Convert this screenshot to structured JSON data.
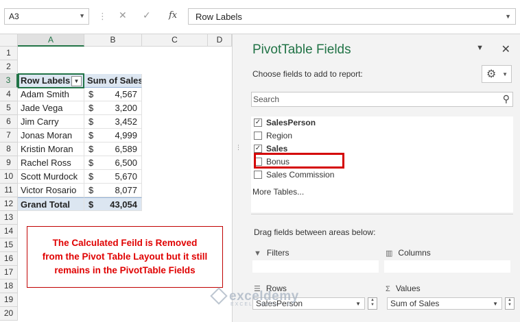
{
  "formula_bar": {
    "name_box": "A3",
    "cancel_icon": "✕",
    "enter_icon": "✓",
    "fx_label": "fx",
    "formula": "Row Labels"
  },
  "grid": {
    "columns": [
      "A",
      "B",
      "C",
      "D"
    ],
    "rows": [
      "1",
      "2",
      "3",
      "4",
      "5",
      "6",
      "7",
      "8",
      "9",
      "10",
      "11",
      "12",
      "13",
      "14",
      "15",
      "16",
      "17",
      "18",
      "19",
      "20"
    ],
    "header": {
      "label": "Row Labels",
      "value": "Sum of Sales"
    },
    "data": [
      {
        "name": "Adam Smith",
        "currency": "$",
        "value": "4,567"
      },
      {
        "name": "Jade Vega",
        "currency": "$",
        "value": "3,200"
      },
      {
        "name": "Jim Carry",
        "currency": "$",
        "value": "3,452"
      },
      {
        "name": "Jonas Moran",
        "currency": "$",
        "value": "4,999"
      },
      {
        "name": "Kristin Moran",
        "currency": "$",
        "value": "6,589"
      },
      {
        "name": "Rachel Ross",
        "currency": "$",
        "value": "6,500"
      },
      {
        "name": "Scott Murdock",
        "currency": "$",
        "value": "5,670"
      },
      {
        "name": "Victor Rosario",
        "currency": "$",
        "value": "8,077"
      }
    ],
    "total": {
      "label": "Grand Total",
      "currency": "$",
      "value": "43,054"
    }
  },
  "callout": {
    "line1": "The Calculated Feild is Removed",
    "line2": "from the Pivot Table Layout but it still",
    "line3": "remains in the PivotTable Fields"
  },
  "pivot_pane": {
    "title": "PivotTable Fields",
    "choose_label": "Choose fields to add to report:",
    "search_placeholder": "Search",
    "fields": [
      {
        "label": "SalesPerson",
        "checked": true,
        "bold": true
      },
      {
        "label": "Region",
        "checked": false,
        "bold": false
      },
      {
        "label": "Sales",
        "checked": true,
        "bold": true
      },
      {
        "label": "Bonus",
        "checked": false,
        "bold": false
      },
      {
        "label": "Sales Commission",
        "checked": false,
        "bold": false
      }
    ],
    "more_tables": "More Tables...",
    "drag_label": "Drag fields between areas below:",
    "areas": {
      "filters": "Filters",
      "columns": "Columns",
      "rows": "Rows",
      "values": "Values"
    },
    "rows_chip": "SalesPerson",
    "values_chip": "Sum of Sales",
    "colors": {
      "accent": "#217346",
      "highlight": "#d40000",
      "pivot_header": "#dce6f1"
    }
  },
  "watermark": {
    "name": "exceldemy",
    "tagline": "EXCEL · DATA · BI"
  }
}
